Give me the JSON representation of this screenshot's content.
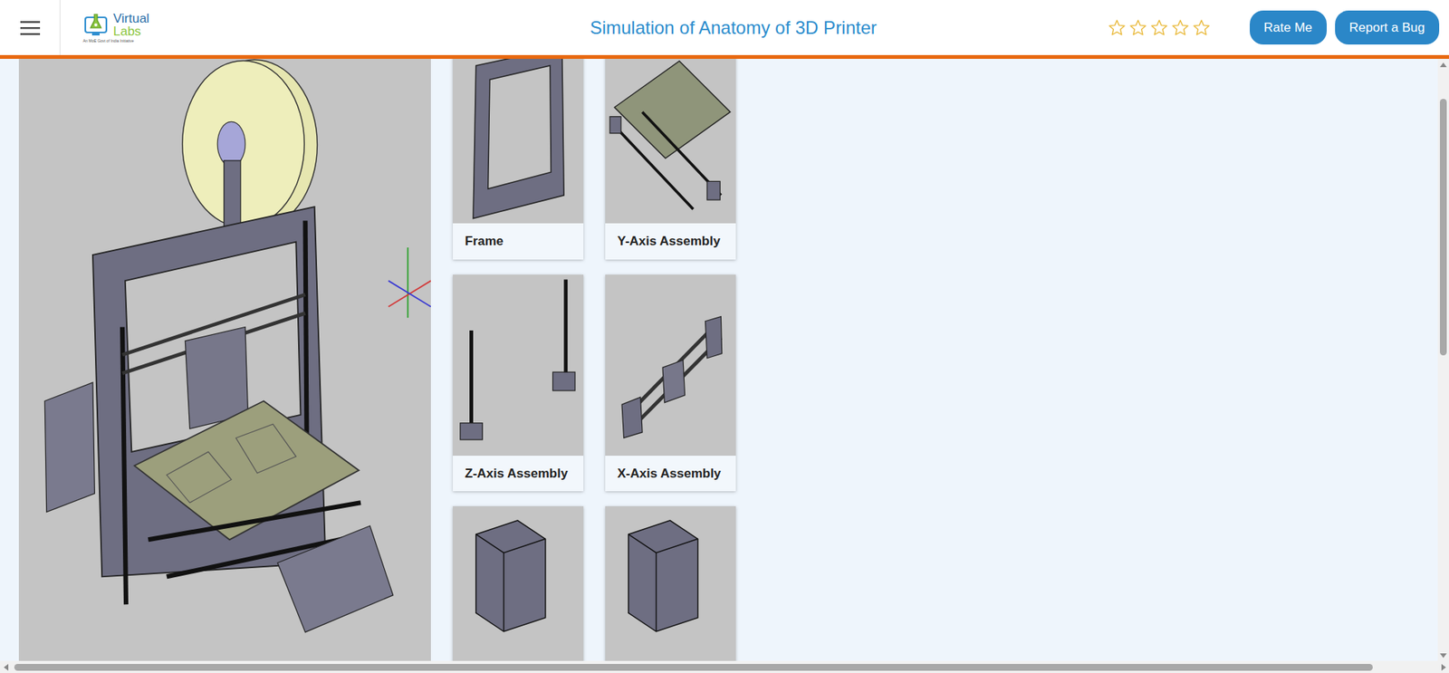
{
  "header": {
    "logo": {
      "line1": "Virtual",
      "line2": "Labs",
      "tagline": "An MoE Govt of India Initiative"
    },
    "title": "Simulation of Anatomy of 3D Printer",
    "rating": {
      "stars": 0
    },
    "buttons": [
      "Rate Me",
      "Report a Bug"
    ]
  },
  "components": [
    {
      "label": "Frame",
      "kind": "frame"
    },
    {
      "label": "Y-Axis Assembly",
      "kind": "y-axis"
    },
    {
      "label": "Z-Axis Assembly",
      "kind": "z-axis"
    },
    {
      "label": "X-Axis Assembly",
      "kind": "x-axis"
    },
    {
      "kind": "box"
    },
    {
      "kind": "box"
    }
  ]
}
